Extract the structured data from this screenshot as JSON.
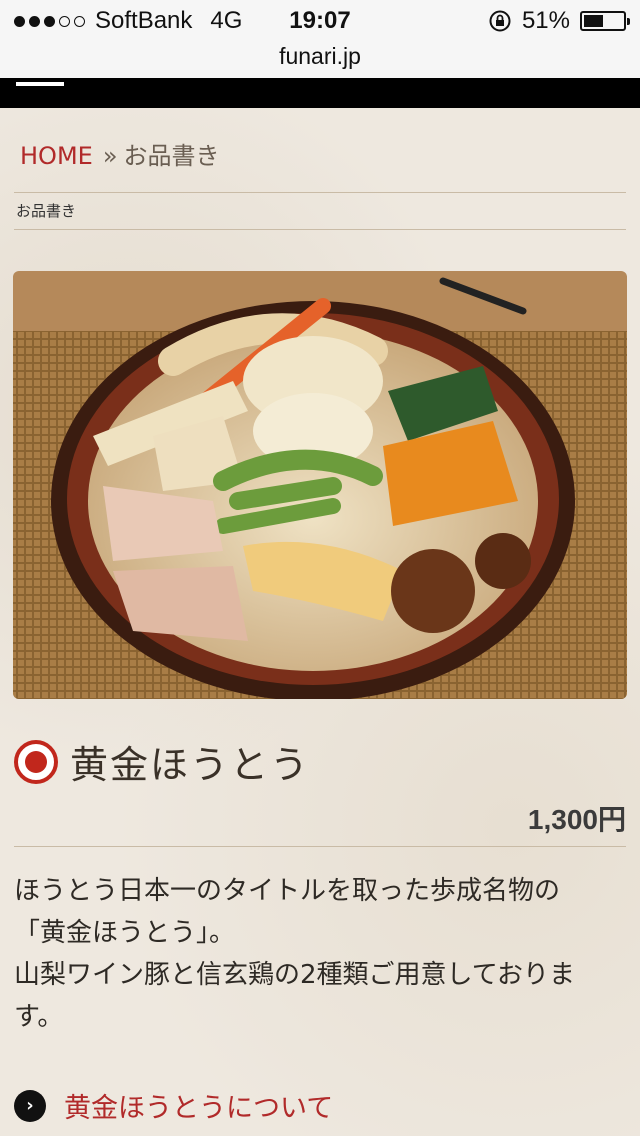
{
  "status_bar": {
    "signal_dots": 5,
    "signal_filled": 3,
    "carrier": "SoftBank",
    "network": "4G",
    "time": "19:07",
    "battery_percent": "51%",
    "battery_level": 0.51,
    "rotation_lock_icon": "rotation-lock-icon"
  },
  "browser": {
    "url": "funari.jp"
  },
  "breadcrumb": {
    "home": "HOME",
    "separator": "»",
    "current": "お品書き"
  },
  "page": {
    "subtitle": "お品書き",
    "item_title": "黄金ほうとう",
    "price": "1,300円",
    "description": [
      "ほうとう日本一のタイトルを取った歩成名物の",
      "「黄金ほうとう」。",
      "山梨ワイン豚と信玄鶏の2種類ご用意しておりま",
      "す。"
    ],
    "link_text": "黄金ほうとうについて"
  },
  "colors": {
    "accent": "#b12a2a",
    "nav_bg": "#000000",
    "page_bg": "#eee8df"
  }
}
